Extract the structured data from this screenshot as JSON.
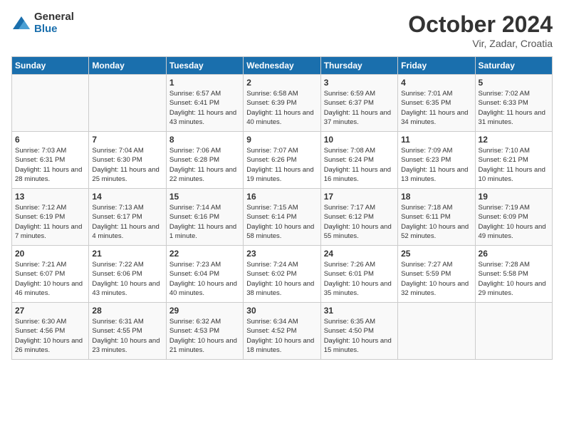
{
  "header": {
    "logo_general": "General",
    "logo_blue": "Blue",
    "title": "October 2024",
    "location": "Vir, Zadar, Croatia"
  },
  "days_of_week": [
    "Sunday",
    "Monday",
    "Tuesday",
    "Wednesday",
    "Thursday",
    "Friday",
    "Saturday"
  ],
  "weeks": [
    [
      {
        "day": "",
        "detail": ""
      },
      {
        "day": "",
        "detail": ""
      },
      {
        "day": "1",
        "detail": "Sunrise: 6:57 AM\nSunset: 6:41 PM\nDaylight: 11 hours and 43 minutes."
      },
      {
        "day": "2",
        "detail": "Sunrise: 6:58 AM\nSunset: 6:39 PM\nDaylight: 11 hours and 40 minutes."
      },
      {
        "day": "3",
        "detail": "Sunrise: 6:59 AM\nSunset: 6:37 PM\nDaylight: 11 hours and 37 minutes."
      },
      {
        "day": "4",
        "detail": "Sunrise: 7:01 AM\nSunset: 6:35 PM\nDaylight: 11 hours and 34 minutes."
      },
      {
        "day": "5",
        "detail": "Sunrise: 7:02 AM\nSunset: 6:33 PM\nDaylight: 11 hours and 31 minutes."
      }
    ],
    [
      {
        "day": "6",
        "detail": "Sunrise: 7:03 AM\nSunset: 6:31 PM\nDaylight: 11 hours and 28 minutes."
      },
      {
        "day": "7",
        "detail": "Sunrise: 7:04 AM\nSunset: 6:30 PM\nDaylight: 11 hours and 25 minutes."
      },
      {
        "day": "8",
        "detail": "Sunrise: 7:06 AM\nSunset: 6:28 PM\nDaylight: 11 hours and 22 minutes."
      },
      {
        "day": "9",
        "detail": "Sunrise: 7:07 AM\nSunset: 6:26 PM\nDaylight: 11 hours and 19 minutes."
      },
      {
        "day": "10",
        "detail": "Sunrise: 7:08 AM\nSunset: 6:24 PM\nDaylight: 11 hours and 16 minutes."
      },
      {
        "day": "11",
        "detail": "Sunrise: 7:09 AM\nSunset: 6:23 PM\nDaylight: 11 hours and 13 minutes."
      },
      {
        "day": "12",
        "detail": "Sunrise: 7:10 AM\nSunset: 6:21 PM\nDaylight: 11 hours and 10 minutes."
      }
    ],
    [
      {
        "day": "13",
        "detail": "Sunrise: 7:12 AM\nSunset: 6:19 PM\nDaylight: 11 hours and 7 minutes."
      },
      {
        "day": "14",
        "detail": "Sunrise: 7:13 AM\nSunset: 6:17 PM\nDaylight: 11 hours and 4 minutes."
      },
      {
        "day": "15",
        "detail": "Sunrise: 7:14 AM\nSunset: 6:16 PM\nDaylight: 11 hours and 1 minute."
      },
      {
        "day": "16",
        "detail": "Sunrise: 7:15 AM\nSunset: 6:14 PM\nDaylight: 10 hours and 58 minutes."
      },
      {
        "day": "17",
        "detail": "Sunrise: 7:17 AM\nSunset: 6:12 PM\nDaylight: 10 hours and 55 minutes."
      },
      {
        "day": "18",
        "detail": "Sunrise: 7:18 AM\nSunset: 6:11 PM\nDaylight: 10 hours and 52 minutes."
      },
      {
        "day": "19",
        "detail": "Sunrise: 7:19 AM\nSunset: 6:09 PM\nDaylight: 10 hours and 49 minutes."
      }
    ],
    [
      {
        "day": "20",
        "detail": "Sunrise: 7:21 AM\nSunset: 6:07 PM\nDaylight: 10 hours and 46 minutes."
      },
      {
        "day": "21",
        "detail": "Sunrise: 7:22 AM\nSunset: 6:06 PM\nDaylight: 10 hours and 43 minutes."
      },
      {
        "day": "22",
        "detail": "Sunrise: 7:23 AM\nSunset: 6:04 PM\nDaylight: 10 hours and 40 minutes."
      },
      {
        "day": "23",
        "detail": "Sunrise: 7:24 AM\nSunset: 6:02 PM\nDaylight: 10 hours and 38 minutes."
      },
      {
        "day": "24",
        "detail": "Sunrise: 7:26 AM\nSunset: 6:01 PM\nDaylight: 10 hours and 35 minutes."
      },
      {
        "day": "25",
        "detail": "Sunrise: 7:27 AM\nSunset: 5:59 PM\nDaylight: 10 hours and 32 minutes."
      },
      {
        "day": "26",
        "detail": "Sunrise: 7:28 AM\nSunset: 5:58 PM\nDaylight: 10 hours and 29 minutes."
      }
    ],
    [
      {
        "day": "27",
        "detail": "Sunrise: 6:30 AM\nSunset: 4:56 PM\nDaylight: 10 hours and 26 minutes."
      },
      {
        "day": "28",
        "detail": "Sunrise: 6:31 AM\nSunset: 4:55 PM\nDaylight: 10 hours and 23 minutes."
      },
      {
        "day": "29",
        "detail": "Sunrise: 6:32 AM\nSunset: 4:53 PM\nDaylight: 10 hours and 21 minutes."
      },
      {
        "day": "30",
        "detail": "Sunrise: 6:34 AM\nSunset: 4:52 PM\nDaylight: 10 hours and 18 minutes."
      },
      {
        "day": "31",
        "detail": "Sunrise: 6:35 AM\nSunset: 4:50 PM\nDaylight: 10 hours and 15 minutes."
      },
      {
        "day": "",
        "detail": ""
      },
      {
        "day": "",
        "detail": ""
      }
    ]
  ]
}
